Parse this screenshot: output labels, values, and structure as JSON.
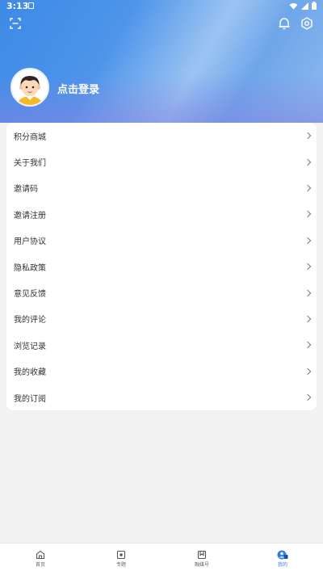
{
  "status_bar": {
    "time": "3:13"
  },
  "profile": {
    "login_text": "点击登录"
  },
  "menu": [
    {
      "label": "积分商城"
    },
    {
      "label": "关于我们"
    },
    {
      "label": "邀请码"
    },
    {
      "label": "邀请注册"
    },
    {
      "label": "用户协议"
    },
    {
      "label": "隐私政策"
    },
    {
      "label": "意见反馈"
    },
    {
      "label": "我的评论"
    },
    {
      "label": "浏览记录"
    },
    {
      "label": "我的收藏"
    },
    {
      "label": "我的订阅"
    }
  ],
  "tabbar": [
    {
      "label": "首页",
      "icon": "home-icon",
      "active": false
    },
    {
      "label": "专题",
      "icon": "topic-icon",
      "active": false
    },
    {
      "label": "融媒号",
      "icon": "bookmark-icon",
      "active": false
    },
    {
      "label": "我的",
      "icon": "profile-icon",
      "active": true
    }
  ],
  "colors": {
    "accent": "#2f7de1",
    "header_start": "#3d8ae6",
    "header_mid": "#9cc4f2"
  }
}
